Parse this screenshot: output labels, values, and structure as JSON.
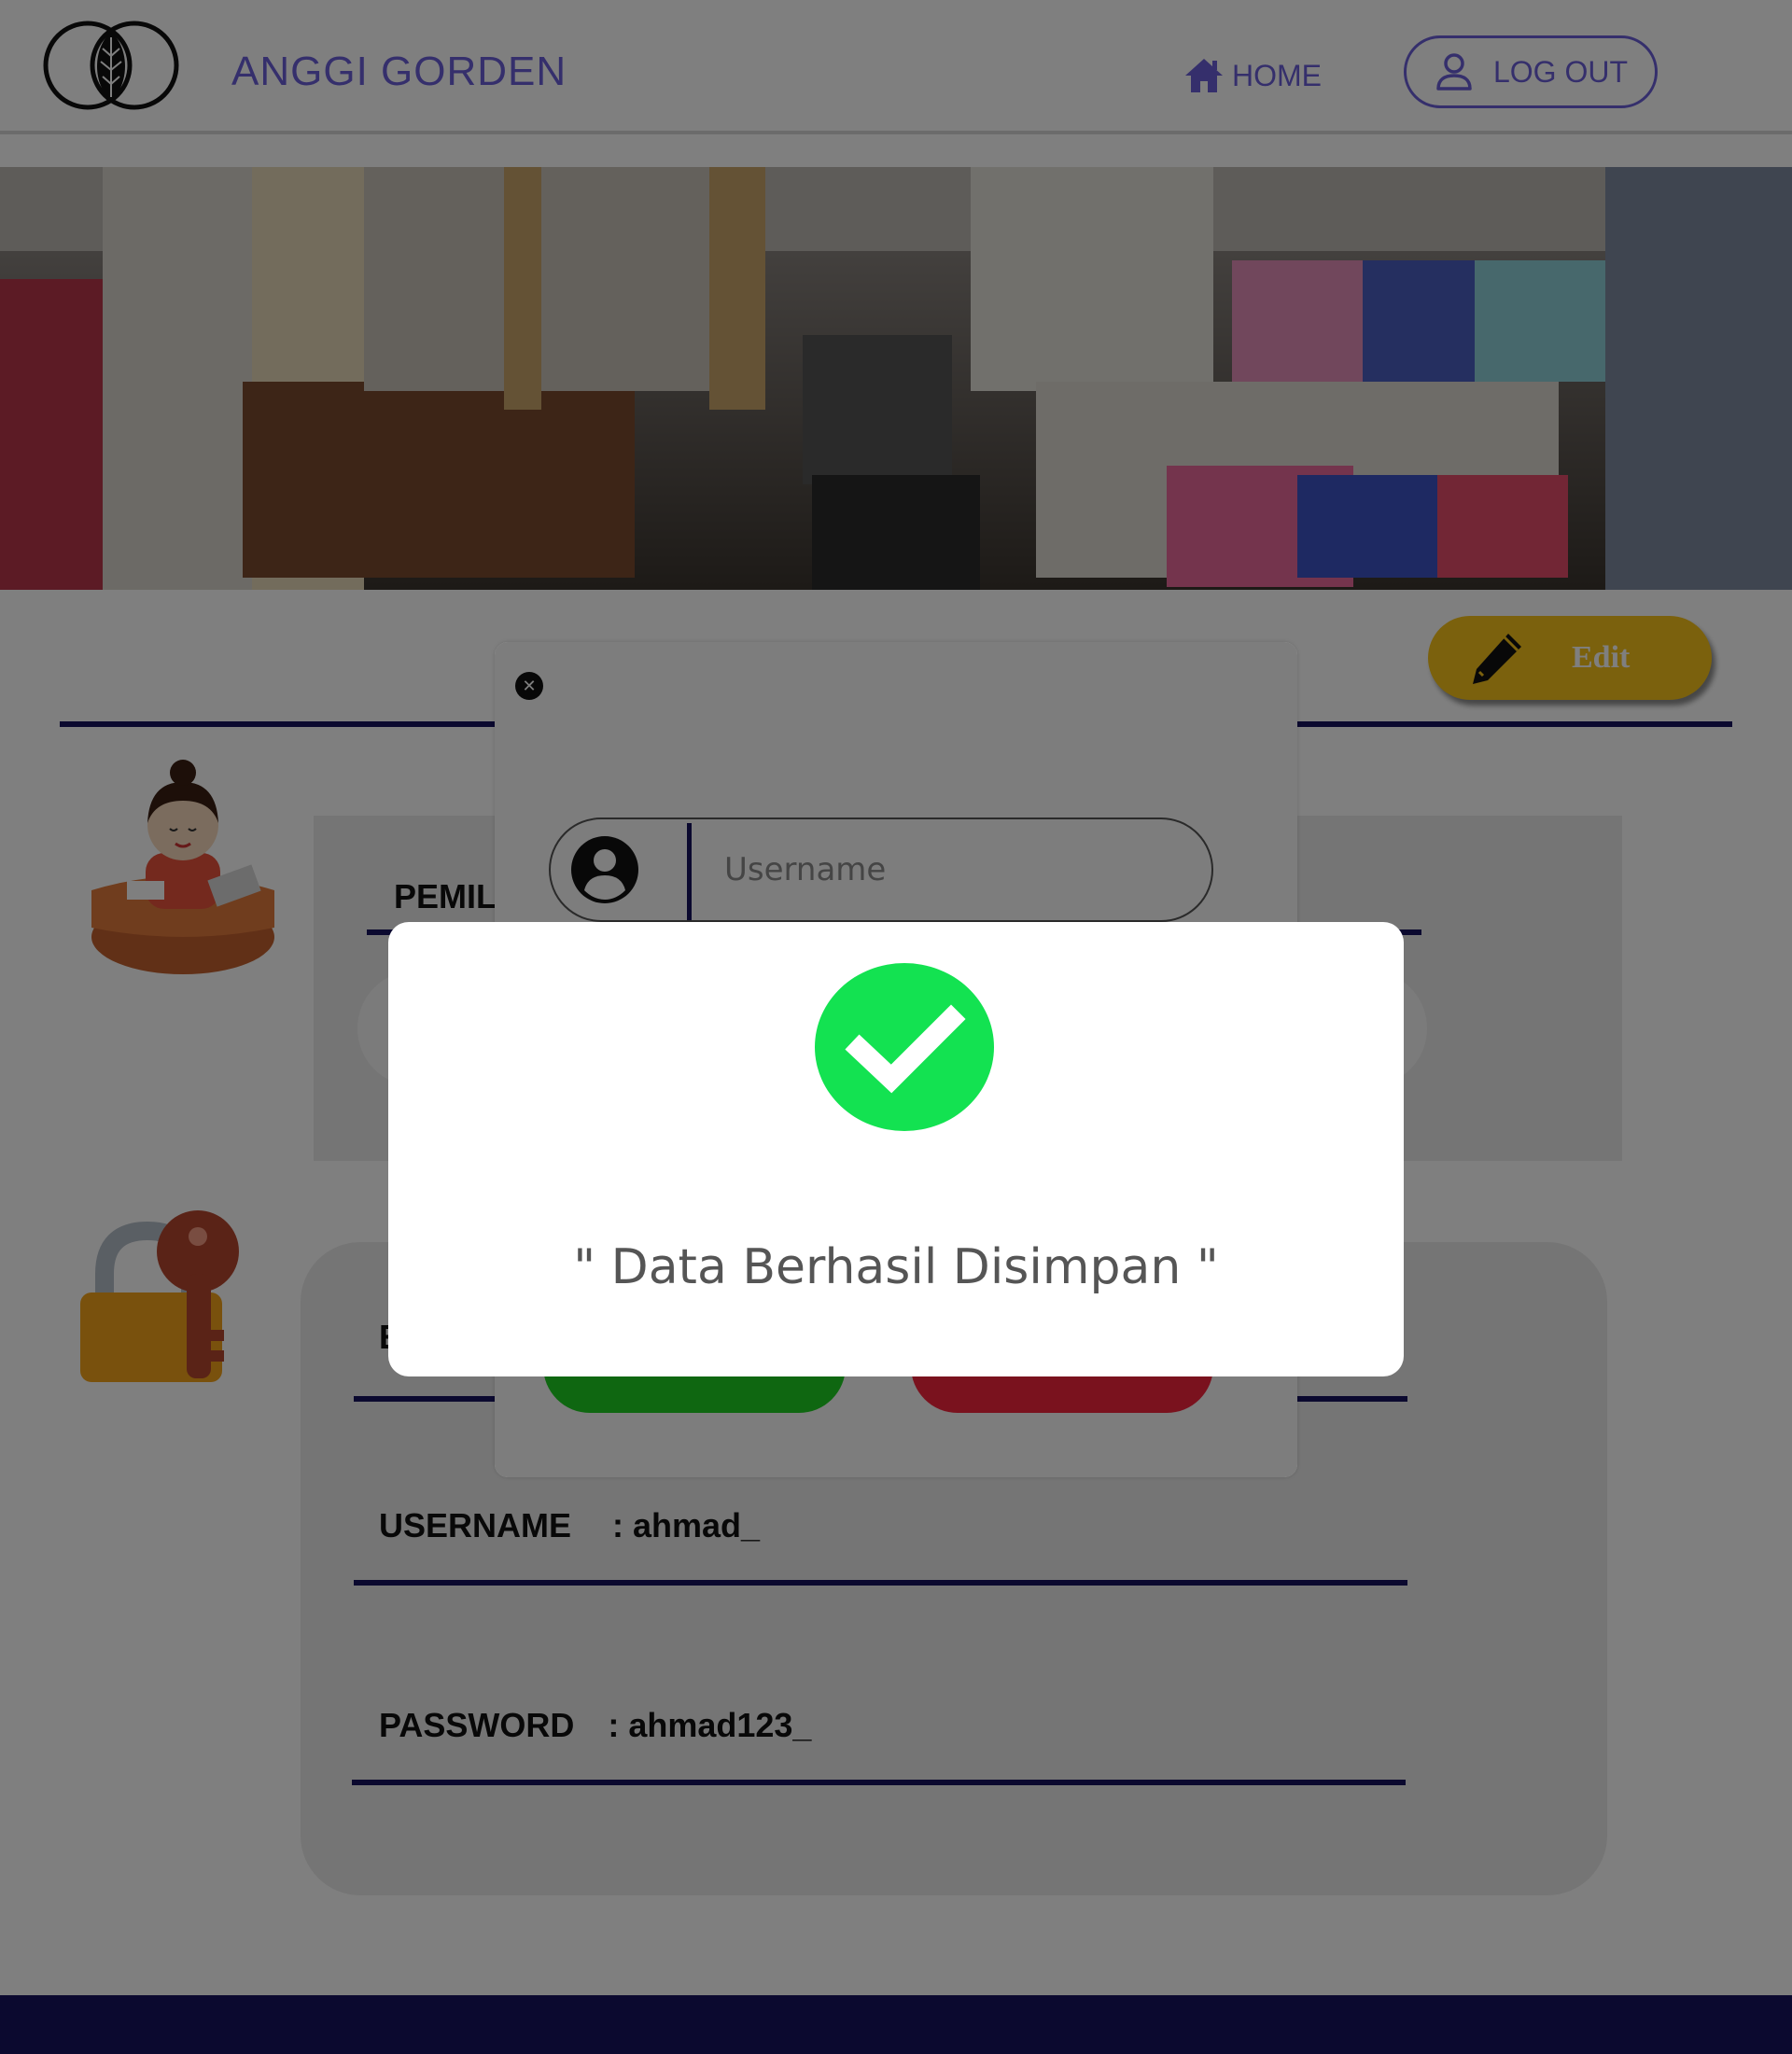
{
  "header": {
    "brand": "ANGGI GORDEN",
    "nav_home": "HOME",
    "logout": "LOG OUT"
  },
  "content": {
    "edit_button": "Edit",
    "owner_label_fragment": "PEMIL",
    "login_label_fragment": "E",
    "username_label": "USERNAME",
    "username_value": ": ahmad_",
    "password_label": "PASSWORD",
    "password_value": ": ahmad123_"
  },
  "edit_modal": {
    "close_glyph": "✕",
    "username_placeholder": "Username"
  },
  "success_dialog": {
    "message": "\" Data Berhasil Disimpan \""
  },
  "colors": {
    "brand": "#6a5fd8",
    "navy": "#16125e",
    "edit_button": "#f6c21b",
    "save_button": "#1ecf22",
    "cancel_button": "#f4243c",
    "success_icon": "#13e251"
  }
}
